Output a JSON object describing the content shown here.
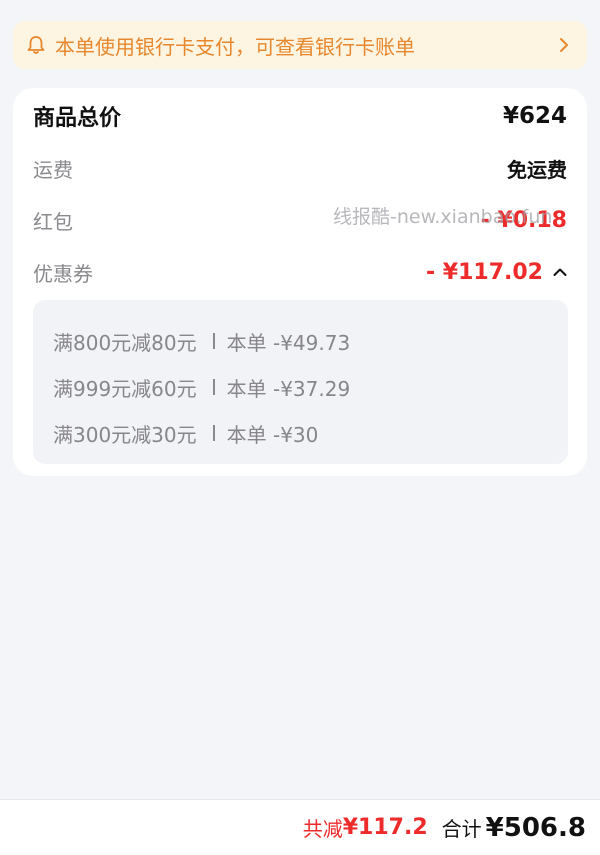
{
  "notice": {
    "text": "本单使用银行卡支付，可查看银行卡账单",
    "icon_left": "bell-icon",
    "icon_right": "chevron-right-icon"
  },
  "price_card": {
    "total": {
      "label": "商品总价",
      "value": "¥624"
    },
    "shipping": {
      "label": "运费",
      "value": "免运费"
    },
    "red_packet": {
      "label": "红包",
      "value": "- ¥0.18"
    },
    "coupon": {
      "label": "优惠券",
      "value": "- ¥117.02",
      "icon": "chevron-up-icon"
    },
    "coupons": [
      {
        "condition": "满800元减80元",
        "detail": "本单 -¥49.73"
      },
      {
        "condition": "满999元减60元",
        "detail": "本单 -¥37.29"
      },
      {
        "condition": "满300元减30元",
        "detail": "本单 -¥30"
      }
    ]
  },
  "watermark": "线报酷-new.xianbao.fun",
  "bottom_bar": {
    "saved_label": "共减",
    "saved_value": "¥117.2",
    "total_label": "合计",
    "total_value": "¥506.8"
  },
  "colors": {
    "accent_red": "#ee2b2b",
    "notice_orange": "#e7882e",
    "notice_bg": "#fdf4e1",
    "page_bg": "#f4f5f9"
  }
}
